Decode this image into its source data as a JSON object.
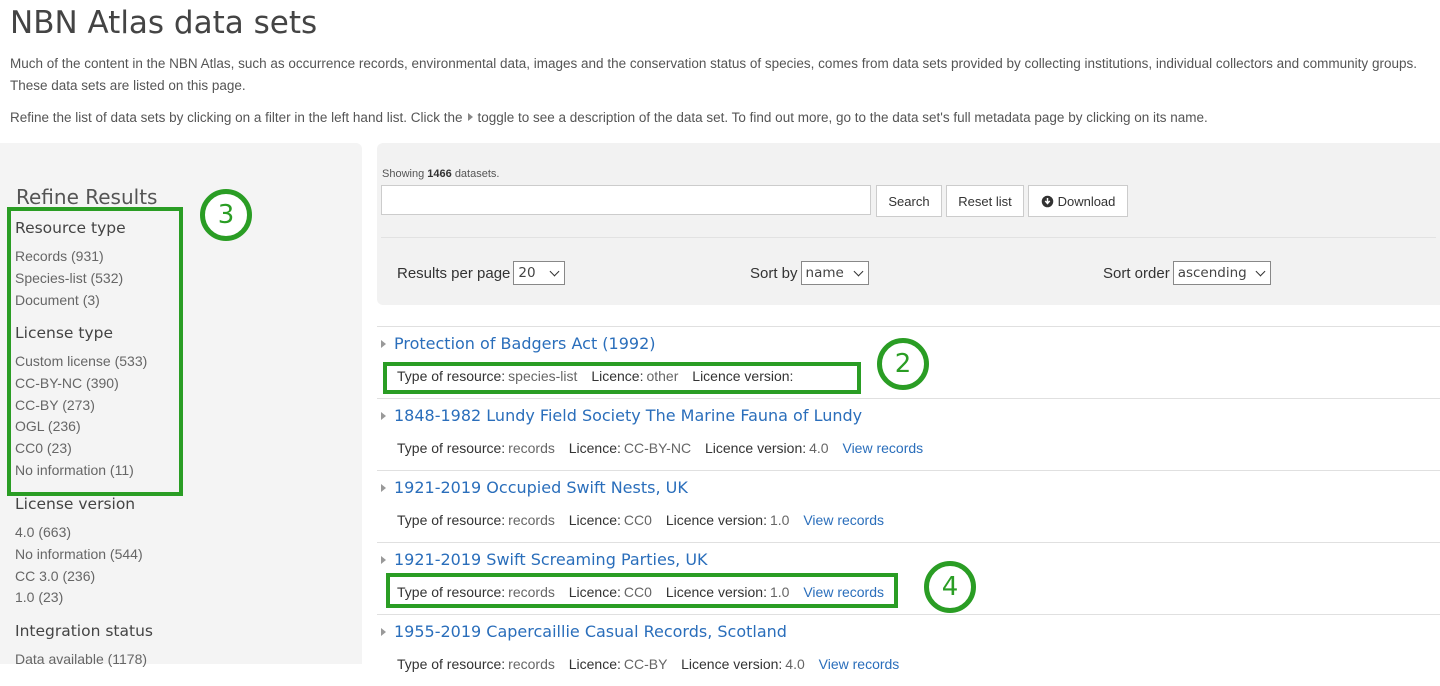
{
  "page": {
    "title": "NBN Atlas data sets",
    "intro": "Much of the content in the NBN Atlas, such as occurrence records, environmental data, images and the conservation status of species, comes from data sets provided by collecting institutions, individual collectors and community groups. These data sets are listed on this page.",
    "instructions_before": "Refine the list of data sets by clicking on a filter in the left hand list. Click the",
    "instructions_after": "toggle to see a description of the data set. To find out more, go to the data set's full metadata page by clicking on its name."
  },
  "sidebar": {
    "title": "Refine Results",
    "groups": [
      {
        "heading": "Resource type",
        "items": [
          "Records (931)",
          "Species-list (532)",
          "Document (3)"
        ]
      },
      {
        "heading": "License type",
        "items": [
          "Custom license (533)",
          "CC-BY-NC (390)",
          "CC-BY (273)",
          "OGL (236)",
          "CC0 (23)",
          "No information (11)"
        ]
      },
      {
        "heading": "License version",
        "items": [
          "4.0 (663)",
          "No information (544)",
          "CC 3.0 (236)",
          "1.0 (23)"
        ]
      },
      {
        "heading": "Integration status",
        "items": [
          "Data available (1178)"
        ]
      }
    ]
  },
  "toolbar": {
    "showing_prefix": "Showing",
    "count": "1466",
    "showing_suffix": "datasets.",
    "search_placeholder": "",
    "search_label": "Search",
    "reset_label": "Reset list",
    "download_label": "Download"
  },
  "controls": {
    "per_page_label": "Results per page",
    "per_page_value": "20",
    "sort_by_label": "Sort by",
    "sort_by_value": "name",
    "sort_order_label": "Sort order",
    "sort_order_value": "ascending"
  },
  "meta_labels": {
    "type": "Type of resource:",
    "licence": "Licence:",
    "version": "Licence version:",
    "view": "View records"
  },
  "results": [
    {
      "title": "Protection of Badgers Act (1992)",
      "type": "species-list",
      "licence": "other",
      "version": ""
    },
    {
      "title": "1848-1982 Lundy Field Society The Marine Fauna of Lundy",
      "type": "records",
      "licence": "CC-BY-NC",
      "version": "4.0"
    },
    {
      "title": "1921-2019 Occupied Swift Nests, UK",
      "type": "records",
      "licence": "CC0",
      "version": "1.0"
    },
    {
      "title": "1921-2019 Swift Screaming Parties, UK",
      "type": "records",
      "licence": "CC0",
      "version": "1.0"
    },
    {
      "title": "1955-2019 Capercaillie Casual Records, Scotland",
      "type": "records",
      "licence": "CC-BY",
      "version": "4.0"
    }
  ],
  "annotations": {
    "badge_2": "2",
    "badge_3": "3",
    "badge_4": "4"
  },
  "colors": {
    "highlight": "#2a9d24",
    "link": "#2a6ebb"
  }
}
